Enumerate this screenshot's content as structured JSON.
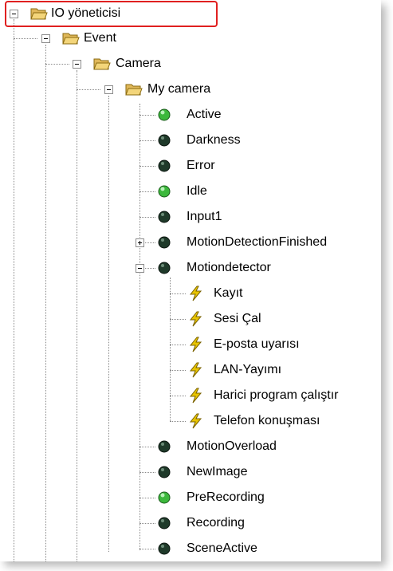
{
  "tree": {
    "root": {
      "label": "IO yöneticisi",
      "icon": "folder-open-icon",
      "expanded": true
    },
    "items": [
      {
        "label": "Event",
        "icon": "folder-open-icon",
        "expanded": true
      },
      {
        "label": "Camera",
        "icon": "folder-open-icon",
        "expanded": true
      },
      {
        "label": "My camera",
        "icon": "folder-open-icon",
        "expanded": true
      },
      {
        "label": "Active",
        "icon": "green-status-icon"
      },
      {
        "label": "Darkness",
        "icon": "dark-status-icon"
      },
      {
        "label": "Error",
        "icon": "dark-status-icon"
      },
      {
        "label": "Idle",
        "icon": "green-status-icon"
      },
      {
        "label": "Input1",
        "icon": "dark-status-icon"
      },
      {
        "label": "MotionDetectionFinished",
        "icon": "dark-status-icon",
        "expanded": false
      },
      {
        "label": "Motiondetector",
        "icon": "dark-status-icon",
        "expanded": true
      },
      {
        "label": "Kayıt",
        "icon": "lightning-icon"
      },
      {
        "label": "Sesi Çal",
        "icon": "lightning-icon"
      },
      {
        "label": "E-posta uyarısı",
        "icon": "lightning-icon"
      },
      {
        "label": "LAN-Yayımı",
        "icon": "lightning-icon"
      },
      {
        "label": "Harici program çalıştır",
        "icon": "lightning-icon"
      },
      {
        "label": "Telefon konuşması",
        "icon": "lightning-icon"
      },
      {
        "label": "MotionOverload",
        "icon": "dark-status-icon"
      },
      {
        "label": "NewImage",
        "icon": "dark-status-icon"
      },
      {
        "label": "PreRecording",
        "icon": "green-status-icon"
      },
      {
        "label": "Recording",
        "icon": "dark-status-icon"
      },
      {
        "label": "SceneActive",
        "icon": "dark-status-icon"
      }
    ]
  },
  "colors": {
    "highlight_border": "#e02020",
    "folder": "#f3d57a",
    "status_green": "#3cb83c",
    "status_dark": "#1f3a2a",
    "lightning": "#e8c400"
  }
}
